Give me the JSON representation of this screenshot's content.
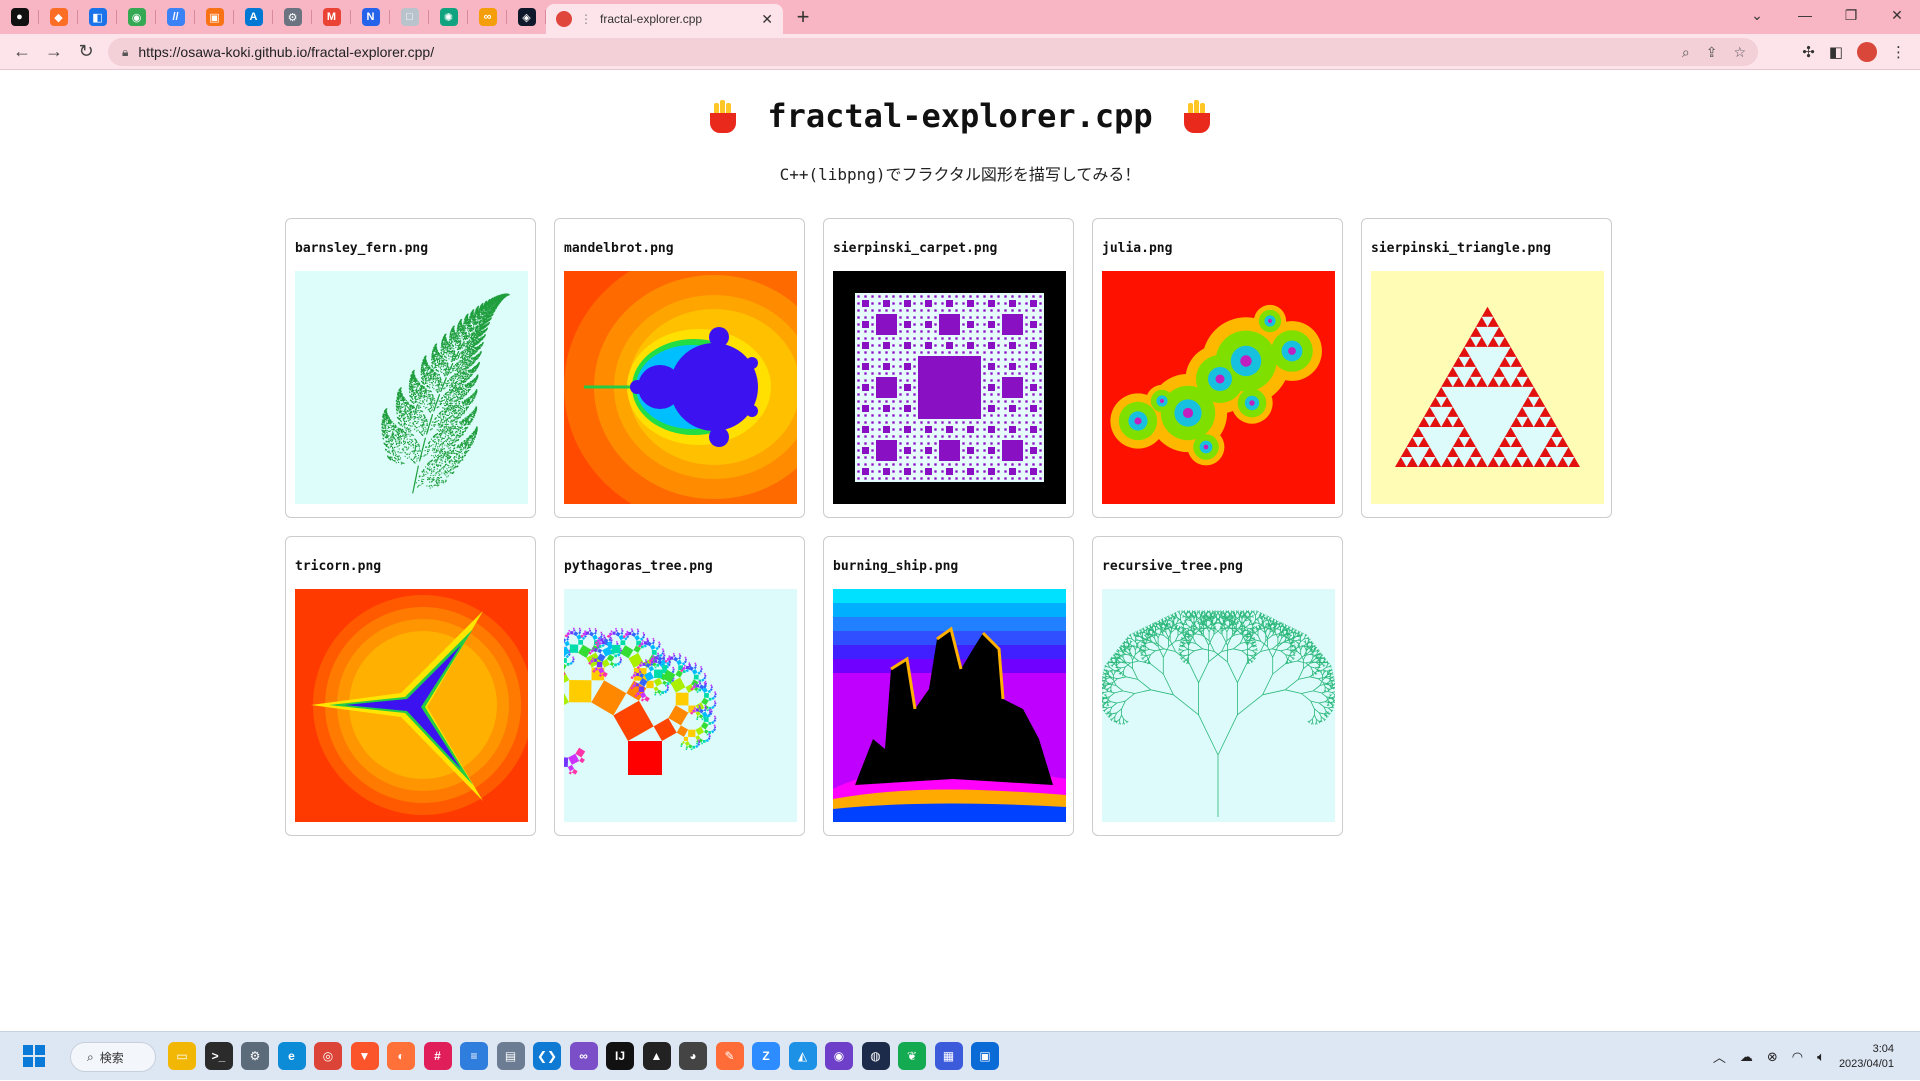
{
  "browser": {
    "pinned_tabs": [
      {
        "icon": "github-icon",
        "color": "#111111",
        "glyph": "●"
      },
      {
        "icon": "gitlab-icon",
        "color": "#fc6d26",
        "glyph": "◆"
      },
      {
        "icon": "code-review-icon",
        "color": "#1a73e8",
        "glyph": "◧"
      },
      {
        "icon": "green-circle-icon",
        "color": "#34a853",
        "glyph": "◉"
      },
      {
        "icon": "slash-icon",
        "color": "#3b82f6",
        "glyph": "//"
      },
      {
        "icon": "package-icon",
        "color": "#f97316",
        "glyph": "▣"
      },
      {
        "icon": "azure-icon",
        "color": "#0078d4",
        "glyph": "A"
      },
      {
        "icon": "settings-icon",
        "color": "#6b7280",
        "glyph": "⚙"
      },
      {
        "icon": "gmail-icon",
        "color": "#ea4335",
        "glyph": "M"
      },
      {
        "icon": "notion-icon",
        "color": "#2563eb",
        "glyph": "N"
      },
      {
        "icon": "blank-page-icon",
        "color": "#b9c3cc",
        "glyph": "□"
      },
      {
        "icon": "openai-icon",
        "color": "#10a37f",
        "glyph": "✺"
      },
      {
        "icon": "link-icon",
        "color": "#f59e0b",
        "glyph": "∞"
      },
      {
        "icon": "diamond-icon",
        "color": "#0f172a",
        "glyph": "◈"
      }
    ],
    "active_tab": {
      "title": "fractal-explorer.cpp"
    },
    "url": "https://osawa-koki.github.io/fractal-explorer.cpp/"
  },
  "page": {
    "title": "fractal-explorer.cpp",
    "subtitle": "C++(libpng)でフラクタル図形を描写してみる！",
    "images": [
      {
        "name": "barnsley_fern.png",
        "kind": "fern"
      },
      {
        "name": "mandelbrot.png",
        "kind": "mandelbrot"
      },
      {
        "name": "sierpinski_carpet.png",
        "kind": "carpet"
      },
      {
        "name": "julia.png",
        "kind": "julia"
      },
      {
        "name": "sierpinski_triangle.png",
        "kind": "triangle"
      },
      {
        "name": "tricorn.png",
        "kind": "tricorn"
      },
      {
        "name": "pythagoras_tree.png",
        "kind": "pythagoras"
      },
      {
        "name": "burning_ship.png",
        "kind": "ship"
      },
      {
        "name": "recursive_tree.png",
        "kind": "tree"
      }
    ]
  },
  "taskbar": {
    "search_label": "検索",
    "apps": [
      {
        "icon": "file-explorer-icon",
        "color": "#f2b705",
        "glyph": "▭"
      },
      {
        "icon": "terminal-icon",
        "color": "#2b2b2b",
        "glyph": ">_"
      },
      {
        "icon": "settings-icon",
        "color": "#5c6b7a",
        "glyph": "⚙"
      },
      {
        "icon": "edge-icon",
        "color": "#0c8bd6",
        "glyph": "e"
      },
      {
        "icon": "chrome-icon",
        "color": "#db4437",
        "glyph": "◎"
      },
      {
        "icon": "brave-icon",
        "color": "#fb542b",
        "glyph": "▼"
      },
      {
        "icon": "firefox-icon",
        "color": "#ff7139",
        "glyph": "◐"
      },
      {
        "icon": "slack-icon",
        "color": "#e01e5a",
        "glyph": "#"
      },
      {
        "icon": "notepad-icon",
        "color": "#2f7ddc",
        "glyph": "≡"
      },
      {
        "icon": "remote-desktop-icon",
        "color": "#6b7c93",
        "glyph": "▤"
      },
      {
        "icon": "vscode-icon",
        "color": "#0e7ad4",
        "glyph": "❮❯"
      },
      {
        "icon": "visual-studio-icon",
        "color": "#7b4fc8",
        "glyph": "∞"
      },
      {
        "icon": "jetbrains-icon",
        "color": "#111111",
        "glyph": "IJ"
      },
      {
        "icon": "inkscape-icon",
        "color": "#222222",
        "glyph": "▲"
      },
      {
        "icon": "panda-icon",
        "color": "#444444",
        "glyph": "◕"
      },
      {
        "icon": "postman-icon",
        "color": "#ff6c37",
        "glyph": "✎"
      },
      {
        "icon": "zoom-icon",
        "color": "#2d8cff",
        "glyph": "Z"
      },
      {
        "icon": "docker-icon",
        "color": "#1d91e6",
        "glyph": "◭"
      },
      {
        "icon": "github-desktop-icon",
        "color": "#6e40c9",
        "glyph": "◉"
      },
      {
        "icon": "vpn-icon",
        "color": "#1c2b4a",
        "glyph": "◍"
      },
      {
        "icon": "mongodb-icon",
        "color": "#13aa52",
        "glyph": "❦"
      },
      {
        "icon": "grid-app-icon",
        "color": "#3b5bdb",
        "glyph": "▦"
      },
      {
        "icon": "remote-icon",
        "color": "#0a6ad6",
        "glyph": "▣"
      }
    ],
    "time": "3:04",
    "date": "2023/04/01"
  }
}
